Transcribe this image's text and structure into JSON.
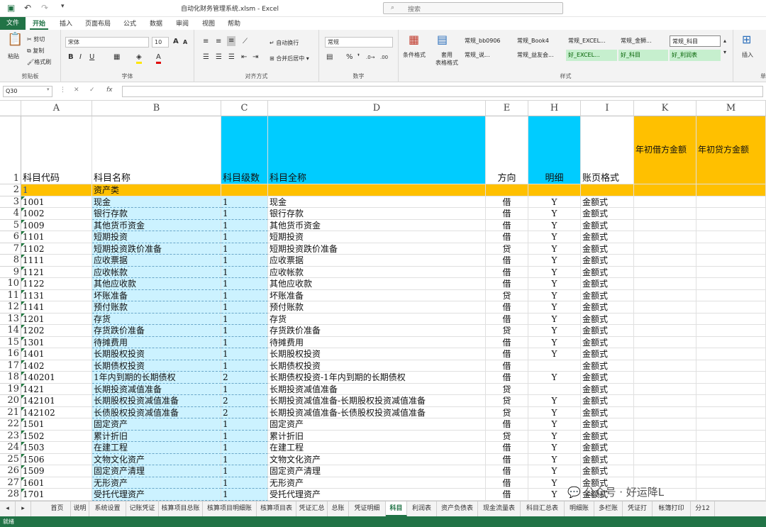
{
  "window": {
    "title": "自动化财务管理系统.xlsm  -  Excel",
    "search_placeholder": "搜索"
  },
  "ribbon_tabs": [
    "文件",
    "开始",
    "插入",
    "页面布局",
    "公式",
    "数据",
    "审阅",
    "视图",
    "帮助"
  ],
  "ribbon": {
    "clipboard": {
      "paste": "粘贴",
      "cut": "剪切",
      "copy": "复制",
      "format_painter": "格式刷",
      "label": "剪贴板"
    },
    "font": {
      "name": "宋体",
      "size": "10",
      "label": "字体"
    },
    "align": {
      "wrap": "自动换行",
      "merge": "合并后居中",
      "label": "对齐方式"
    },
    "number": {
      "format": "常规",
      "label": "数字"
    },
    "styles": {
      "cond": "条件格式",
      "table": "套用\n表格格式",
      "label": "样式",
      "cells": [
        "常规_bb0906",
        "常规_Book4",
        "常规_EXCEL...",
        "常规_金狮...",
        "常规_科目",
        "常规_说...",
        "常规_益友会...",
        "好_EXCEL...",
        "好_科目",
        "好_利润表"
      ]
    },
    "cells_grp": {
      "insert": "插入",
      "label": "单"
    }
  },
  "formula_bar": {
    "name_box": "Q30",
    "formula": ""
  },
  "columns": [
    {
      "letter": "A",
      "header": "科目代码"
    },
    {
      "letter": "B",
      "header": "科目名称"
    },
    {
      "letter": "C",
      "header": "科目级数"
    },
    {
      "letter": "D",
      "header": "科目全称"
    },
    {
      "letter": "E",
      "header": "方向"
    },
    {
      "letter": "H",
      "header": "明细"
    },
    {
      "letter": "I",
      "header": "账页格式"
    },
    {
      "letter": "K",
      "header": "年初借方金额"
    },
    {
      "letter": "M",
      "header": "年初贷方金额"
    }
  ],
  "rows": [
    {
      "n": "2",
      "code": "1",
      "name": "资产类",
      "level": "",
      "full": "",
      "dir": "",
      "detail": "",
      "fmt": ""
    },
    {
      "n": "3",
      "code": "1001",
      "name": "现金",
      "level": "1",
      "full": "现金",
      "dir": "借",
      "detail": "Y",
      "fmt": "金额式"
    },
    {
      "n": "4",
      "code": "1002",
      "name": "银行存款",
      "level": "1",
      "full": "银行存款",
      "dir": "借",
      "detail": "Y",
      "fmt": "金额式"
    },
    {
      "n": "5",
      "code": "1009",
      "name": "其他货币资金",
      "level": "1",
      "full": "其他货币资金",
      "dir": "借",
      "detail": "Y",
      "fmt": "金额式"
    },
    {
      "n": "6",
      "code": "1101",
      "name": "短期投资",
      "level": "1",
      "full": "短期投资",
      "dir": "借",
      "detail": "Y",
      "fmt": "金额式"
    },
    {
      "n": "7",
      "code": "1102",
      "name": "短期投资跌价准备",
      "level": "1",
      "full": "短期投资跌价准备",
      "dir": "贷",
      "detail": "Y",
      "fmt": "金额式"
    },
    {
      "n": "8",
      "code": "1111",
      "name": "应收票据",
      "level": "1",
      "full": "应收票据",
      "dir": "借",
      "detail": "Y",
      "fmt": "金额式"
    },
    {
      "n": "9",
      "code": "1121",
      "name": "应收帐款",
      "level": "1",
      "full": "应收帐款",
      "dir": "借",
      "detail": "Y",
      "fmt": "金额式"
    },
    {
      "n": "10",
      "code": "1122",
      "name": "其他应收款",
      "level": "1",
      "full": "其他应收款",
      "dir": "借",
      "detail": "Y",
      "fmt": "金额式"
    },
    {
      "n": "11",
      "code": "1131",
      "name": "坏账准备",
      "level": "1",
      "full": "坏账准备",
      "dir": "贷",
      "detail": "Y",
      "fmt": "金额式"
    },
    {
      "n": "12",
      "code": "1141",
      "name": "预付账款",
      "level": "1",
      "full": "预付账款",
      "dir": "借",
      "detail": "Y",
      "fmt": "金额式"
    },
    {
      "n": "13",
      "code": "1201",
      "name": "存货",
      "level": "1",
      "full": "存货",
      "dir": "借",
      "detail": "Y",
      "fmt": "金额式"
    },
    {
      "n": "14",
      "code": "1202",
      "name": "存货跌价准备",
      "level": "1",
      "full": "存货跌价准备",
      "dir": "贷",
      "detail": "Y",
      "fmt": "金额式"
    },
    {
      "n": "15",
      "code": "1301",
      "name": "待摊费用",
      "level": "1",
      "full": "待摊费用",
      "dir": "借",
      "detail": "Y",
      "fmt": "金额式"
    },
    {
      "n": "16",
      "code": "1401",
      "name": "长期股权投资",
      "level": "1",
      "full": "长期股权投资",
      "dir": "借",
      "detail": "Y",
      "fmt": "金额式"
    },
    {
      "n": "17",
      "code": "1402",
      "name": "长期债权投资",
      "level": "1",
      "full": "长期债权投资",
      "dir": "借",
      "detail": "",
      "fmt": "金额式"
    },
    {
      "n": "18",
      "code": "140201",
      "name": "1年内到期的长期债权",
      "level": "2",
      "full": "长期债权投资-1年内到期的长期债权",
      "dir": "借",
      "detail": "Y",
      "fmt": "金额式"
    },
    {
      "n": "19",
      "code": "1421",
      "name": "长期投资减值准备",
      "level": "1",
      "full": "长期投资减值准备",
      "dir": "贷",
      "detail": "",
      "fmt": "金额式"
    },
    {
      "n": "20",
      "code": "142101",
      "name": "长期股权投资减值准备",
      "level": "2",
      "full": "长期投资减值准备-长期股权投资减值准备",
      "dir": "贷",
      "detail": "Y",
      "fmt": "金额式"
    },
    {
      "n": "21",
      "code": "142102",
      "name": "长债股权投资减值准备",
      "level": "2",
      "full": "长期投资减值准备-长债股权投资减值准备",
      "dir": "贷",
      "detail": "Y",
      "fmt": "金额式"
    },
    {
      "n": "22",
      "code": "1501",
      "name": "固定资产",
      "level": "1",
      "full": "固定资产",
      "dir": "借",
      "detail": "Y",
      "fmt": "金额式"
    },
    {
      "n": "23",
      "code": "1502",
      "name": "累计折旧",
      "level": "1",
      "full": "累计折旧",
      "dir": "贷",
      "detail": "Y",
      "fmt": "金额式"
    },
    {
      "n": "24",
      "code": "1503",
      "name": "在建工程",
      "level": "1",
      "full": "在建工程",
      "dir": "借",
      "detail": "Y",
      "fmt": "金额式"
    },
    {
      "n": "25",
      "code": "1506",
      "name": "文物文化资产",
      "level": "1",
      "full": "文物文化资产",
      "dir": "借",
      "detail": "Y",
      "fmt": "金额式"
    },
    {
      "n": "26",
      "code": "1509",
      "name": "固定资产清理",
      "level": "1",
      "full": "固定资产清理",
      "dir": "借",
      "detail": "Y",
      "fmt": "金额式"
    },
    {
      "n": "27",
      "code": "1601",
      "name": "无形资产",
      "level": "1",
      "full": "无形资产",
      "dir": "借",
      "detail": "Y",
      "fmt": "金额式"
    },
    {
      "n": "28",
      "code": "1701",
      "name": "受托代理资产",
      "level": "1",
      "full": "受托代理资产",
      "dir": "借",
      "detail": "Y",
      "fmt": "金额式"
    }
  ],
  "sheet_tabs": [
    "首页",
    "说明",
    "系统设置",
    "记账凭证",
    "核算项目总账",
    "核算项目明细账",
    "核算项目表",
    "凭证汇总",
    "总账",
    "凭证明细",
    "科目",
    "利润表",
    "资产负债表",
    "现金流量表",
    "科目汇总表",
    "明细账",
    "多栏账",
    "凭证打",
    "帐簿打印",
    "分12"
  ],
  "active_sheet": "科目",
  "status": "就绪",
  "watermark": "公众号 · 好运降L",
  "colors": {
    "accent": "#217346",
    "cyan": "#00ccff",
    "orange": "#ffc000",
    "light_cyan": "#ccf2ff"
  }
}
